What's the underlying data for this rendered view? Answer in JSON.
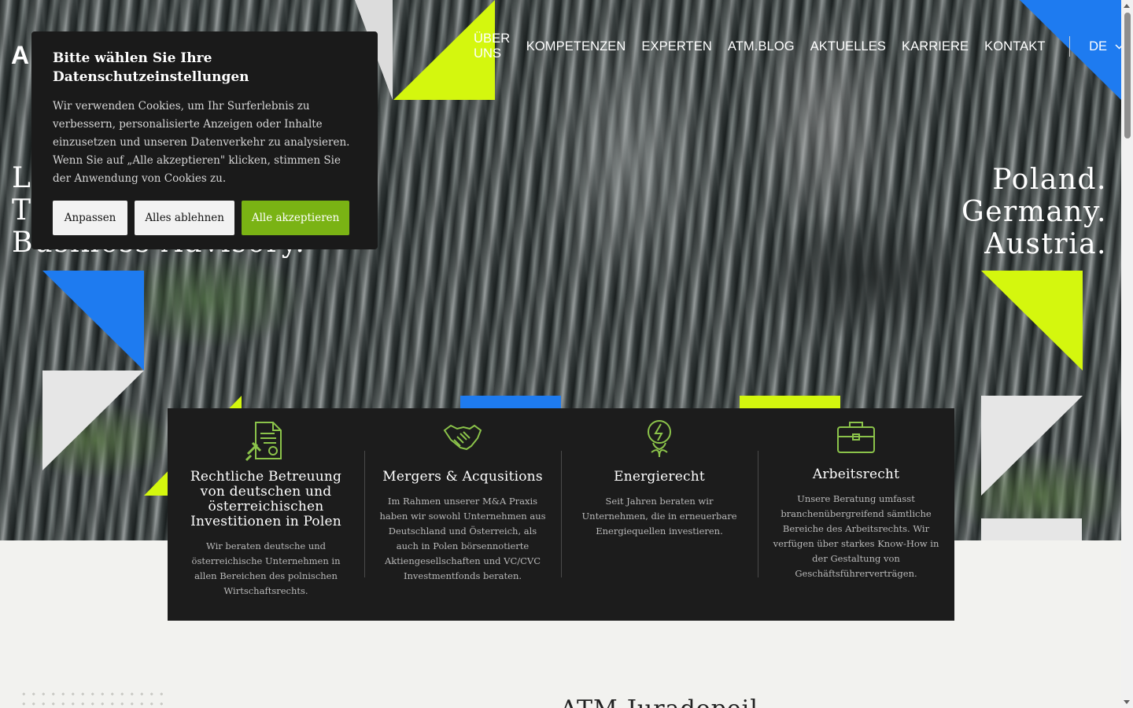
{
  "nav": {
    "logo": "A",
    "items": [
      "ÜBER UNS",
      "KOMPETENZEN",
      "EXPERTEN",
      "ATM.BLOG",
      "AKTUELLES",
      "KARRIERE",
      "KONTAKT"
    ],
    "language": "DE"
  },
  "hero": {
    "tagline_left": [
      "L",
      "T",
      "Business Advisory."
    ],
    "tagline_right": [
      "Poland.",
      "Germany.",
      "Austria."
    ]
  },
  "competences": [
    {
      "icon": "document-gavel-icon",
      "title": "Rechtliche Betreuung von deutschen und österreichischen Investitionen in Polen",
      "text": "Wir beraten deutsche und österreichische Unternehmen in allen Bereichen des polnischen Wirtschaftsrechts."
    },
    {
      "icon": "handshake-icon",
      "title": "Mergers & Acqusitions",
      "text": "Im Rahmen unserer M&A Praxis haben wir sowohl Unternehmen aus Deutschland und Österreich, als auch in Polen börsennotierte Aktiengesellschaften und VC/CVC Investmentfonds beraten."
    },
    {
      "icon": "energy-bulb-icon",
      "title": "Energierecht",
      "text": "Seit Jahren beraten wir Unternehmen, die in erneuerbare Energiequellen investieren."
    },
    {
      "icon": "briefcase-icon",
      "title": "Arbeitsrecht",
      "text": "Unsere Beratung umfasst branchenübergreifend sämtliche Bereiche des Arbeitsrechts. Wir verfügen über starkes Know-How in der Gestaltung von Geschäftsführerverträgen."
    }
  ],
  "section_next": {
    "heading": "ATM-Juradopeil"
  },
  "cookie": {
    "title": "Bitte wählen Sie Ihre Datenschutzeinstellungen",
    "text": "Wir verwenden Cookies, um Ihr Surferlebnis zu verbessern, personalisierte Anzeigen oder Inhalte einzusetzen und unseren Datenverkehr zu analysieren. Wenn Sie auf „Alle akzeptieren\" klicken, stimmen Sie der Anwendung von Cookies zu.",
    "btn_customize": "Anpassen",
    "btn_reject": "Alles ablehnen",
    "btn_accept": "Alle akzeptieren"
  },
  "colors": {
    "accent_green": "#7ab314",
    "lime": "#d4f70e",
    "blue": "#1e7bf0",
    "panel": "#1c1c1c",
    "icon_green": "#8bc34a"
  }
}
